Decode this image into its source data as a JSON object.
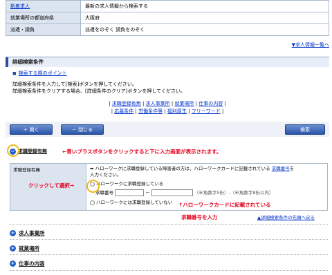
{
  "conditions": [
    {
      "key": "新着求人",
      "key_link": true,
      "value": "最新の求人情報から検索する"
    },
    {
      "key": "就業場所の都道府県",
      "key_link": false,
      "value": "大阪府"
    },
    {
      "key": "派遣・請負",
      "key_link": false,
      "value": "派遣をのぞく  請負をのぞく"
    }
  ],
  "top_link": "▼求人情報一覧へ",
  "section": {
    "title": "詳細検索条件",
    "point": "検索する際のポイント",
    "desc1": "詳細検索条件を入力して[検索]ボタンを押してください。",
    "desc2": "詳細検索条件をクリアする場合、[詳細条件のクリア]ボタンを押してください。",
    "links_line1": [
      "求職登録有無",
      "求人事業所",
      "就業場所",
      "仕事の内容"
    ],
    "links_line2": [
      "応募条件",
      "労働条件等",
      "福利厚生",
      "フリーワード"
    ]
  },
  "buttons": {
    "open": "＋  開く",
    "close": "－  閉じる",
    "search": "検索"
  },
  "toggle_label": "求職登録有無",
  "note_top": "←青いプラスボタンをクリックすると下に入力画面が表示されます。",
  "reg": {
    "key": "求職登録有無",
    "text1": "➡ ハローワークに求職登録している障害者の方は、ハローワークカードに記載されている",
    "text1_link": "求職番号",
    "text1_tail": "を",
    "text2": "入力ください。",
    "opt_registered": "ハローワークに求職登録している",
    "number_label": "求職番号",
    "dash": "－",
    "hint": "（半角数字5桁）-（半角数字8桁以内）",
    "opt_unregistered": "ハローワークには求職登録していない"
  },
  "note_click": "クリックして選択→",
  "note_card": "↑ハローワークカードに記載されている",
  "note_num": "求職番号を入力",
  "bottom_link": "▲詳細検索条件の先頭へ戻る",
  "accordions": [
    "求人事業所",
    "就業場所",
    "仕事の内容"
  ],
  "colors": {
    "accent": "#1f5fc8",
    "note": "#e8001c",
    "highlight": "#f2b71a",
    "link": "#0033cc"
  }
}
